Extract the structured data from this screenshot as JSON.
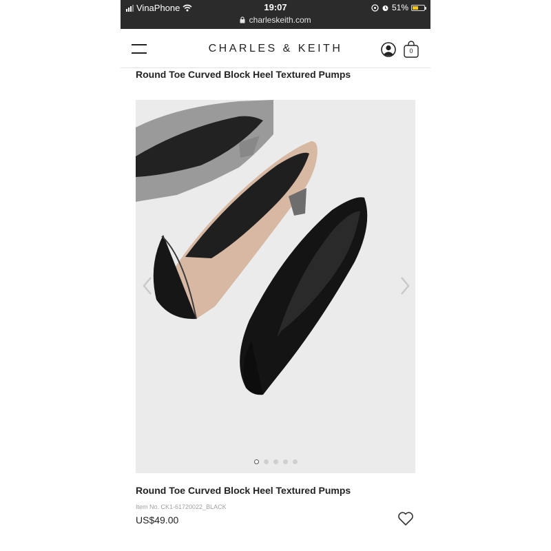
{
  "status_bar": {
    "carrier": "VinaPhone",
    "time": "19:07",
    "url": "charleskeith.com",
    "battery": "51%",
    "battery_level": 0.51
  },
  "header": {
    "brand": "CHARLES & KEITH",
    "bag_count": "0"
  },
  "product": {
    "top_title": "Round Toe Curved Block Heel Textured Pumps",
    "title": "Round Toe Curved Block Heel Textured Pumps",
    "item_no": "Item No. CK1-61720022_BLACK",
    "price": "US$49.00"
  },
  "gallery": {
    "image_count": 5,
    "active_index": 0
  },
  "icons": {
    "menu": "hamburger-icon",
    "account": "user-icon",
    "bag": "shopping-bag-icon",
    "prev": "chevron-left-icon",
    "next": "chevron-right-icon",
    "wishlist": "heart-icon",
    "lock": "lock-icon",
    "wifi": "wifi-icon",
    "alarm": "alarm-icon"
  },
  "colors": {
    "status_bar_bg": "#2b2b2b",
    "gallery_bg": "#ebebeb",
    "battery": "#f2c515"
  }
}
